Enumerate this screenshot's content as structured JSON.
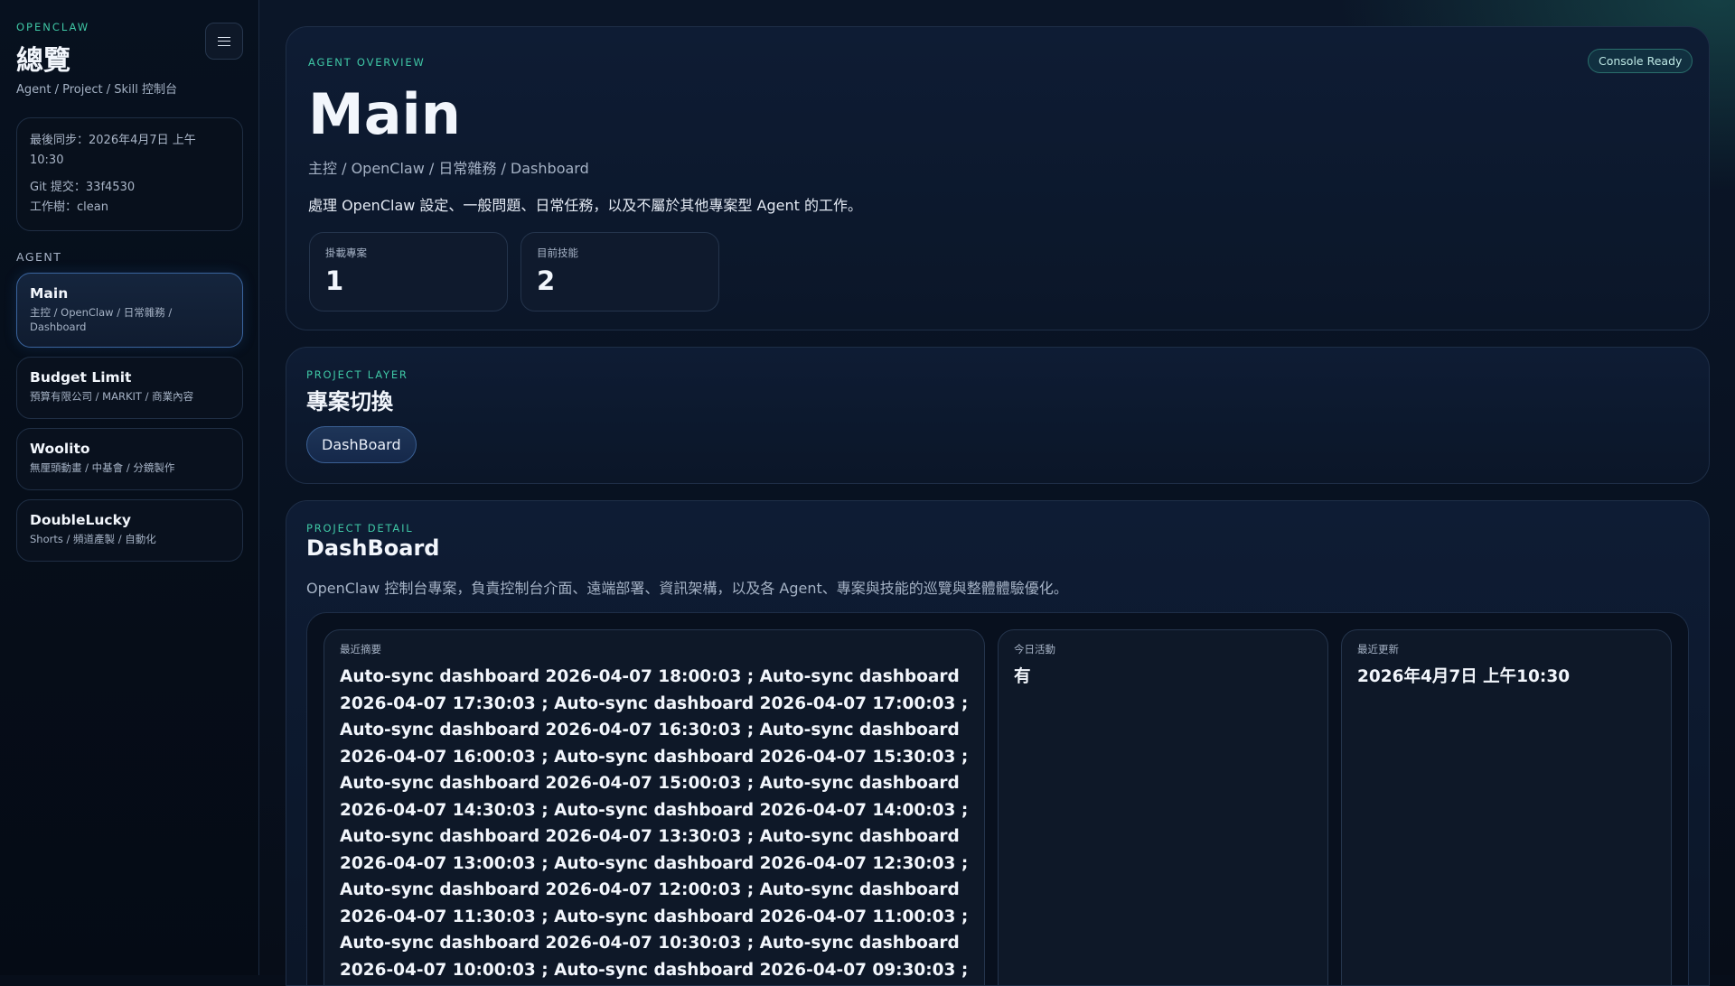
{
  "sidebar": {
    "brand": "OPENCLAW",
    "title": "總覽",
    "subtitle": "Agent / Project / Skill 控制台",
    "menu_icon": "hamburger-icon",
    "info": {
      "last_sync": "最後同步：2026年4月7日 上午 10:30",
      "git_commit": "Git 提交：33f4530",
      "worktree": "工作樹：clean"
    },
    "agent_section_label": "AGENT",
    "agents": [
      {
        "name": "Main",
        "desc": "主控 / OpenClaw / 日常雜務 / Dashboard",
        "active": true
      },
      {
        "name": "Budget Limit",
        "desc": "預算有限公司 / MARKIT / 商業內容"
      },
      {
        "name": "Woolito",
        "desc": "無厘頭動畫 / 中基會 / 分鏡製作"
      },
      {
        "name": "DoubleLucky",
        "desc": "Shorts / 頻道產製 / 自動化"
      }
    ]
  },
  "overview": {
    "eyebrow": "AGENT OVERVIEW",
    "status_badge": "Console Ready",
    "title": "Main",
    "path": "主控 / OpenClaw / 日常雜務 / Dashboard",
    "description": "處理 OpenClaw 設定、一般問題、日常任務，以及不屬於其他專案型 Agent 的工作。",
    "stats": [
      {
        "label": "掛載專案",
        "value": "1"
      },
      {
        "label": "目前技能",
        "value": "2"
      }
    ]
  },
  "project_layer": {
    "eyebrow": "PROJECT LAYER",
    "title": "專案切換",
    "projects": [
      "DashBoard"
    ]
  },
  "project_detail": {
    "eyebrow": "PROJECT DETAIL",
    "title": "DashBoard",
    "description": "OpenClaw 控制台專案，負責控制台介面、遠端部署、資訊架構，以及各 Agent、專案與技能的巡覽與整體體驗優化。",
    "summary_label": "最近摘要",
    "summary": "Auto-sync dashboard 2026-04-07 18:00:03 ; Auto-sync dashboard 2026-04-07 17:30:03 ; Auto-sync dashboard 2026-04-07 17:00:03 ; Auto-sync dashboard 2026-04-07 16:30:03 ; Auto-sync dashboard 2026-04-07 16:00:03 ; Auto-sync dashboard 2026-04-07 15:30:03 ; Auto-sync dashboard 2026-04-07 15:00:03 ; Auto-sync dashboard 2026-04-07 14:30:03 ; Auto-sync dashboard 2026-04-07 14:00:03 ; Auto-sync dashboard 2026-04-07 13:30:03 ; Auto-sync dashboard 2026-04-07 13:00:03 ; Auto-sync dashboard 2026-04-07 12:30:03 ; Auto-sync dashboard 2026-04-07 12:00:03 ; Auto-sync dashboard 2026-04-07 11:30:03 ; Auto-sync dashboard 2026-04-07 11:00:03 ; Auto-sync dashboard 2026-04-07 10:30:03 ; Auto-sync dashboard 2026-04-07 10:00:03 ; Auto-sync dashboard 2026-04-07 09:30:03 ;",
    "today_label": "今日活動",
    "today_value": "有",
    "updated_label": "最近更新",
    "updated_value": "2026年4月7日 上午10:30"
  },
  "colors": {
    "accent": "#3fc7a5",
    "background": "#070e1a",
    "active_border": "#3a649e"
  }
}
